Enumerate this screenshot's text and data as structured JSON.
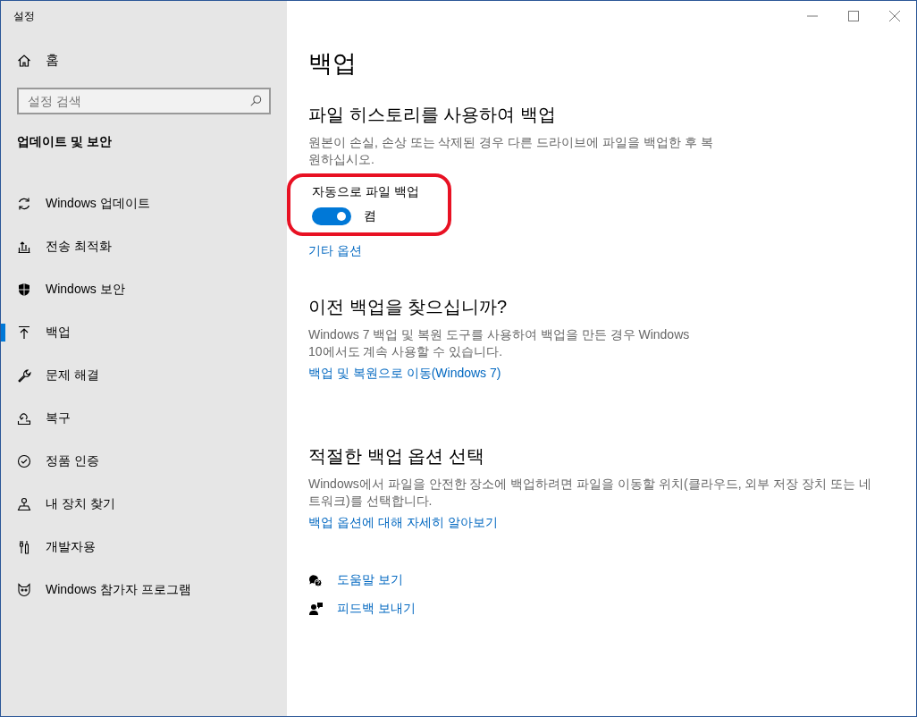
{
  "window": {
    "title": "설정"
  },
  "sidebar": {
    "home": "홈",
    "search": {
      "placeholder": "설정 검색"
    },
    "section_title": "업데이트 및 보안",
    "items": [
      {
        "label": "Windows 업데이트",
        "kind": "sync",
        "selected": false
      },
      {
        "label": "전송 최적화",
        "kind": "delivery",
        "selected": false
      },
      {
        "label": "Windows 보안",
        "kind": "shield",
        "selected": false
      },
      {
        "label": "백업",
        "kind": "backup",
        "selected": true
      },
      {
        "label": "문제 해결",
        "kind": "wrench",
        "selected": false
      },
      {
        "label": "복구",
        "kind": "recovery",
        "selected": false
      },
      {
        "label": "정품 인증",
        "kind": "check",
        "selected": false
      },
      {
        "label": "내 장치 찾기",
        "kind": "person",
        "selected": false
      },
      {
        "label": "개발자용",
        "kind": "tools",
        "selected": false
      },
      {
        "label": "Windows 참가자 프로그램",
        "kind": "insider",
        "selected": false
      }
    ]
  },
  "page": {
    "title": "백업",
    "sections": [
      {
        "heading": "파일 히스토리를 사용하여 백업",
        "description": "원본이 손실, 손상 또는 삭제된 경우 다른 드라이브에 파일을 백업한 후 복원하십시오.",
        "setting": {
          "label": "자동으로 파일 백업",
          "on": true,
          "state_text": "켬",
          "highlighted": true
        },
        "link": "기타 옵션"
      },
      {
        "heading": "이전 백업을 찾으십니까?",
        "description": "Windows 7 백업 및 복원 도구를 사용하여 백업을 만든 경우 Windows 10에서도 계속 사용할 수 있습니다.",
        "link": "백업 및 복원으로 이동(Windows 7)"
      },
      {
        "heading": "적절한 백업 옵션 선택",
        "description": "Windows에서 파일을 안전한 장소에 백업하려면 파일을 이동할 위치(클라우드, 외부 저장 장치 또는 네트워크)를 선택합니다.",
        "link": "백업 옵션에 대해 자세히 알아보기"
      }
    ],
    "help_links": [
      {
        "label": "도움말 보기",
        "kind": "help"
      },
      {
        "label": "피드백 보내기",
        "kind": "feedback"
      }
    ]
  }
}
